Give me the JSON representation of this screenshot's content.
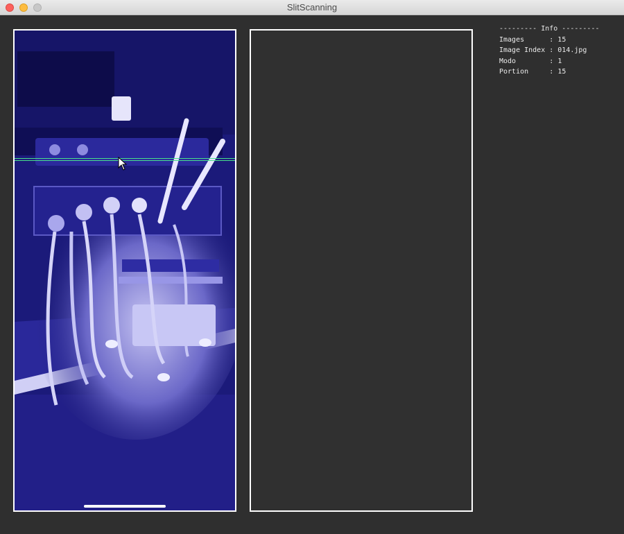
{
  "window": {
    "title": "SlitScanning"
  },
  "info": {
    "header": "--------- Info ---------",
    "rows": [
      {
        "label": "Images",
        "value": "15"
      },
      {
        "label": "Image Index",
        "value": "014.jpg"
      },
      {
        "label": "Modo",
        "value": "1"
      },
      {
        "label": "Portion",
        "value": "15"
      }
    ]
  },
  "colors": {
    "background": "#2f2f2f",
    "photo_tint": "#1b1a7a",
    "scanline": "#48e08a",
    "panel_border": "#ffffff"
  }
}
